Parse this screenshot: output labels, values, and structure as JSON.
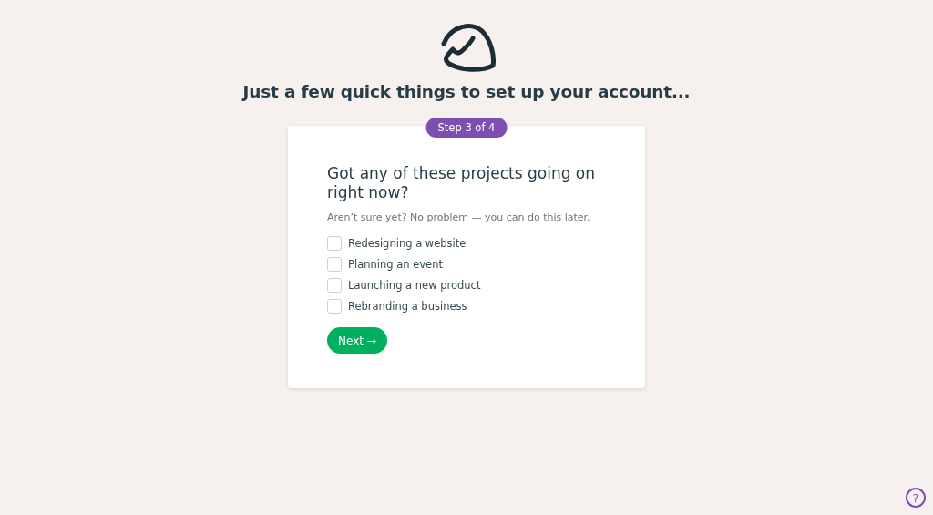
{
  "heading": "Just a few quick things to set up your account...",
  "step_badge": "Step 3 of 4",
  "question": "Got any of these projects going on right now?",
  "hint": "Aren’t sure yet? No problem — you can do this later.",
  "options": [
    {
      "label": "Redesigning a website",
      "checked": false
    },
    {
      "label": "Planning an event",
      "checked": false
    },
    {
      "label": "Launching a new product",
      "checked": false
    },
    {
      "label": "Rebranding a business",
      "checked": false
    }
  ],
  "next_button": "Next →",
  "help_button": "?"
}
